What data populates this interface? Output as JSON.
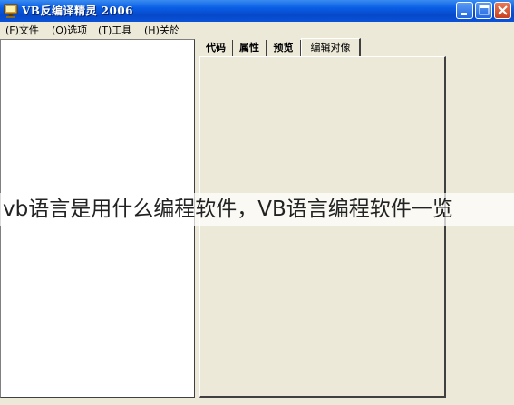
{
  "window": {
    "title": "VB反编译精灵  2006"
  },
  "menu": [
    {
      "key": "(F)",
      "label": "文件"
    },
    {
      "key": "(O)",
      "label": "选项"
    },
    {
      "key": "(T)",
      "label": "工具"
    },
    {
      "key": "(H)",
      "label": "关於"
    }
  ],
  "tabs": [
    {
      "label": "代码",
      "active": false
    },
    {
      "label": "属性",
      "active": false
    },
    {
      "label": "预览",
      "active": false
    },
    {
      "label": "编辑对像",
      "active": true
    }
  ],
  "overlay": {
    "caption": "vb语言是用什么编程软件，VB语言编程软件一览"
  },
  "colors": {
    "titlebar": "#0a5fe6",
    "window_bg": "#ece9d8",
    "close_button": "#c8401e"
  },
  "icons": [
    "app-icon",
    "minimize-icon",
    "maximize-icon",
    "close-icon"
  ]
}
